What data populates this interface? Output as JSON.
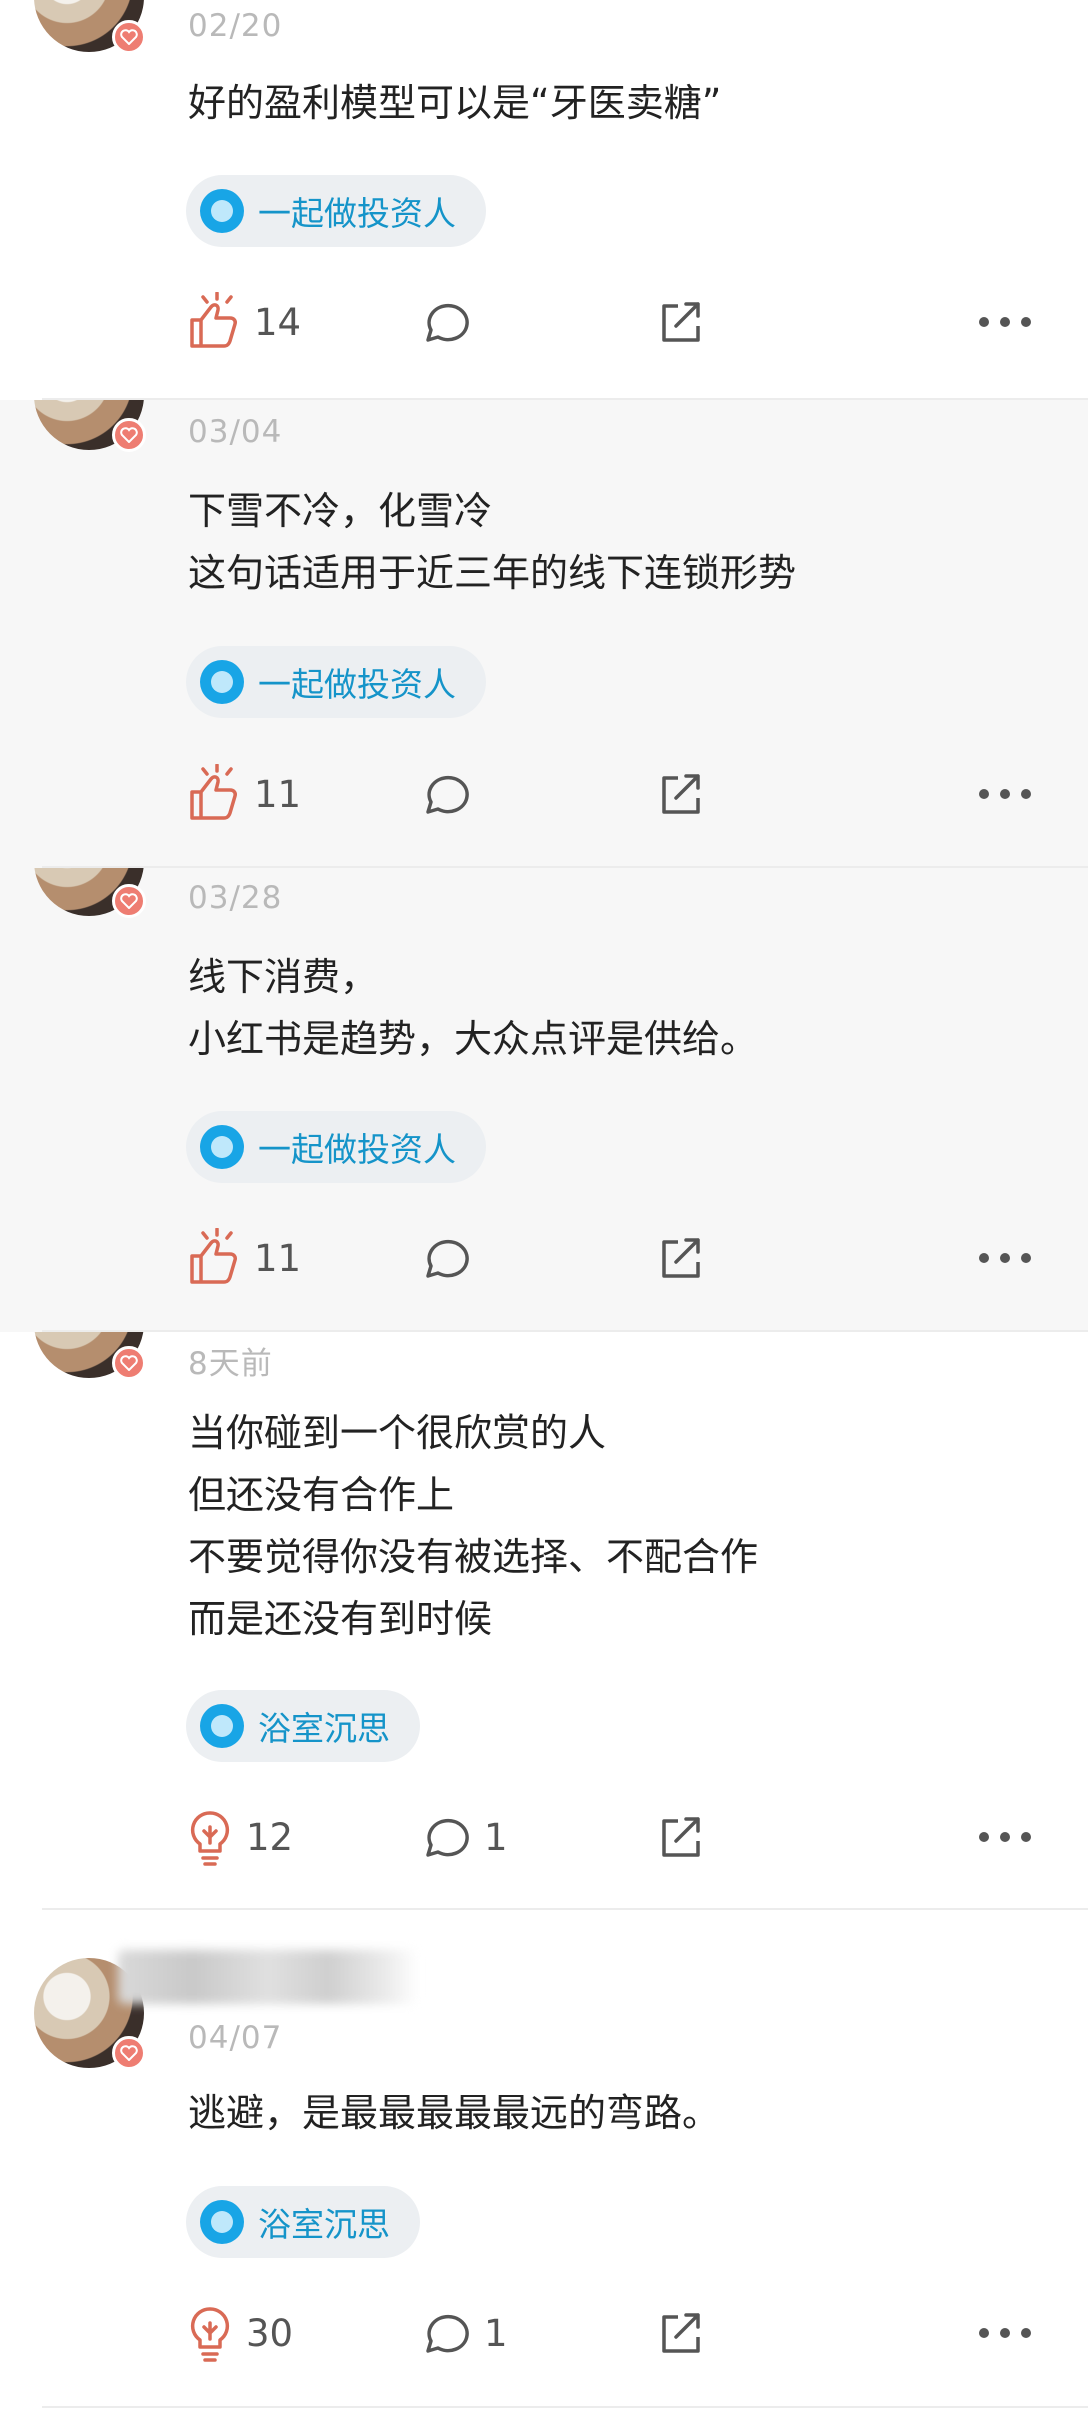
{
  "colors": {
    "like_icon": "#d96a55",
    "topic_accent": "#18a5e6",
    "topic_text": "#1594c9",
    "date_text": "#b9b9b9",
    "shaded_background": "#f7f7f7"
  },
  "posts": [
    {
      "date": "02/20",
      "content": "好的盈利模型可以是“牙医卖糖”",
      "topic": "一起做投资人",
      "like_icon": "thumbs-up-icon",
      "like_count": "14",
      "comment_count": ""
    },
    {
      "date": "03/04",
      "content": "下雪不冷，化雪冷\n这句话适用于近三年的线下连锁形势",
      "topic": "一起做投资人",
      "like_icon": "thumbs-up-icon",
      "like_count": "11",
      "comment_count": ""
    },
    {
      "date": "03/28",
      "content": "线下消费，\n小红书是趋势，大众点评是供给。",
      "topic": "一起做投资人",
      "like_icon": "thumbs-up-icon",
      "like_count": "11",
      "comment_count": ""
    },
    {
      "date": "8天前",
      "content": "当你碰到一个很欣赏的人\n但还没有合作上\n不要觉得你没有被选择、不配合作\n而是还没有到时候",
      "topic": "浴室沉思",
      "like_icon": "lightbulb-icon",
      "like_count": "12",
      "comment_count": "1"
    },
    {
      "date": "04/07",
      "content": "逃避，是最最最最最远的弯路。",
      "topic": "浴室沉思",
      "like_icon": "lightbulb-icon",
      "like_count": "30",
      "comment_count": "1"
    }
  ]
}
